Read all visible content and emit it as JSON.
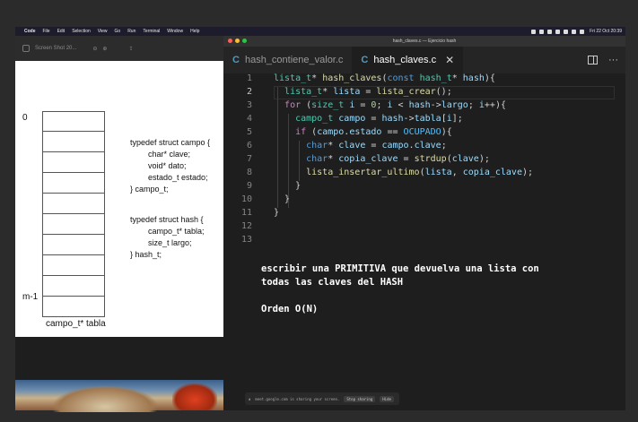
{
  "menubar": {
    "app": "Code",
    "items": [
      "File",
      "Edit",
      "Selection",
      "View",
      "Go",
      "Run",
      "Terminal",
      "Window",
      "Help"
    ],
    "clock": "Fri 22 Oct 20:39"
  },
  "preview": {
    "title": "Screen Shot 20...",
    "index_top": "0",
    "index_bottom": "m-1",
    "table_caption": "campo_t* tabla",
    "struct_campo": "typedef struct campo {\n        char* clave;\n        void* dato;\n        estado_t estado;\n} campo_t;",
    "struct_hash": "typedef struct hash {\n        campo_t* tabla;\n        size_t largo;\n} hash_t;"
  },
  "vscode": {
    "window_title": "hash_claves.c — Ejercicio hash",
    "tabs": [
      {
        "label": "hash_contiene_valor.c",
        "active": false
      },
      {
        "label": "hash_claves.c",
        "active": true
      }
    ],
    "line_numbers": [
      "1",
      "2",
      "3",
      "4",
      "5",
      "6",
      "7",
      "8",
      "9",
      "10",
      "11",
      "12",
      "13"
    ],
    "current_line": 2,
    "note_line1": "escribir una PRIMITIVA que devuelva una lista con",
    "note_line2": "todas las claves del HASH",
    "note_line3": "Orden O(N)",
    "share_text": "meet.google.com is sharing your screen.",
    "share_stop": "Stop sharing",
    "share_hide": "Hide"
  },
  "colors": {
    "editor_bg": "#1e1e1e",
    "type": "#4ec9b0",
    "function": "#dcdcaa",
    "variable": "#9cdcfe",
    "keyword": "#c586c0",
    "constant": "#4fc1ff"
  }
}
